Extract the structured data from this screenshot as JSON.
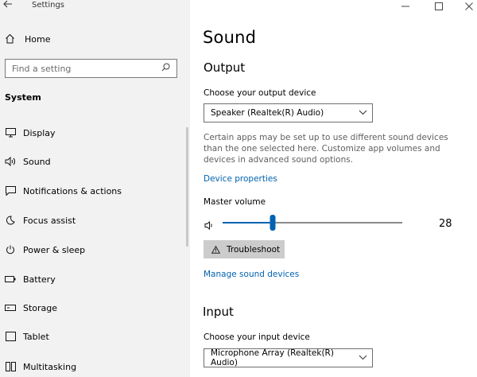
{
  "window": {
    "title": "Settings",
    "back_icon": "back-arrow-icon",
    "controls": [
      "minimize-icon",
      "maximize-icon",
      "close-icon"
    ]
  },
  "sidebar": {
    "home_label": "Home",
    "search": {
      "placeholder": "Find a setting",
      "value": ""
    },
    "section_heading": "System",
    "items": [
      {
        "label": "Display",
        "icon": "monitor-icon"
      },
      {
        "label": "Sound",
        "icon": "speaker-icon",
        "selected": true
      },
      {
        "label": "Notifications & actions",
        "icon": "notification-icon"
      },
      {
        "label": "Focus assist",
        "icon": "moon-icon"
      },
      {
        "label": "Power & sleep",
        "icon": "power-icon"
      },
      {
        "label": "Battery",
        "icon": "battery-icon"
      },
      {
        "label": "Storage",
        "icon": "storage-icon"
      },
      {
        "label": "Tablet",
        "icon": "tablet-icon"
      },
      {
        "label": "Multitasking",
        "icon": "multitasking-icon"
      }
    ]
  },
  "main": {
    "title": "Sound",
    "output": {
      "heading": "Output",
      "device_label": "Choose your output device",
      "device_selected": "Speaker (Realtek(R) Audio)",
      "description": "Certain apps may be set up to use different sound devices than the one selected here. Customize app volumes and devices in advanced sound options.",
      "device_properties_link": "Device properties",
      "master_volume_label": "Master volume",
      "volume_value": 28,
      "volume_display": "28",
      "troubleshoot_label": "Troubleshoot",
      "manage_link": "Manage sound devices"
    },
    "input": {
      "heading": "Input",
      "device_label": "Choose your input device",
      "device_selected": "Microphone Array (Realtek(R) Audio)"
    }
  },
  "colors": {
    "accent": "#0063b1",
    "sidebar_bg": "#f2f2f2",
    "button_bg": "#cccccc"
  }
}
